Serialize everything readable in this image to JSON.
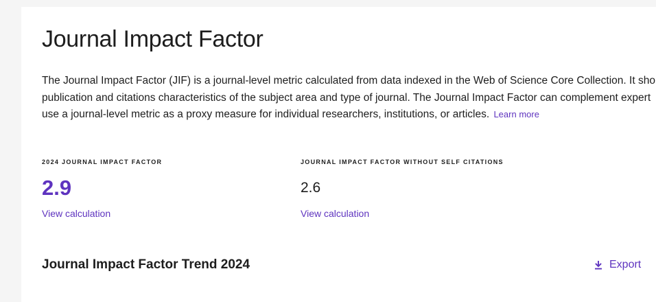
{
  "panel": {
    "title": "Journal Impact Factor",
    "description_lines": [
      "The Journal Impact Factor (JIF) is a journal-level metric calculated from data indexed in the Web of Science Core Collection. It shoul",
      "publication and citations characteristics of the subject area and type of journal. The Journal Impact Factor can complement expert",
      "use a journal-level metric as a proxy measure for individual researchers, institutions, or articles."
    ],
    "learn_more": "Learn more"
  },
  "metrics": [
    {
      "label": "2024 JOURNAL IMPACT FACTOR",
      "value": "2.9",
      "link": "View calculation"
    },
    {
      "label": "JOURNAL IMPACT FACTOR WITHOUT SELF CITATIONS",
      "value": "2.6",
      "link": "View calculation"
    }
  ],
  "trend": {
    "title": "Journal Impact Factor Trend 2024",
    "export_label": "Export",
    "export_icon": "download-icon"
  },
  "colors": {
    "accent": "#5e33bf",
    "text": "#1d1d1d",
    "background": "#f5f5f5",
    "card": "#ffffff"
  }
}
